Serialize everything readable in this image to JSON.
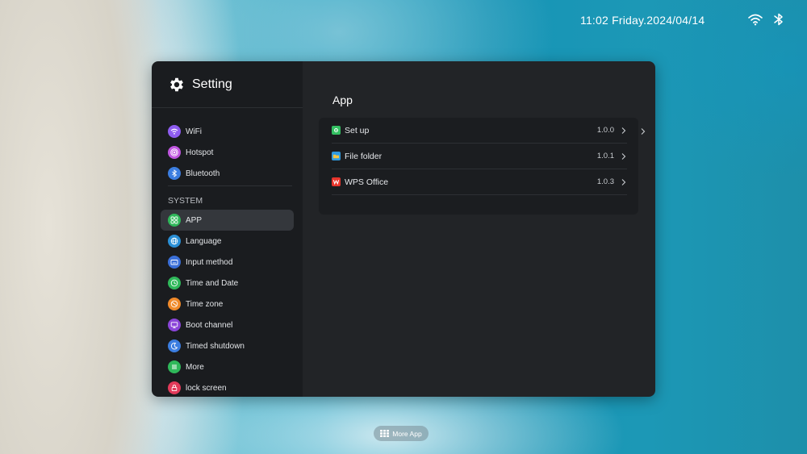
{
  "status_bar": {
    "datetime": "11:02 Friday.2024/04/14",
    "icons": [
      "wifi-icon",
      "bluetooth-icon"
    ]
  },
  "sidebar": {
    "title": "Setting",
    "network_items": [
      {
        "label": "WiFi",
        "icon": "wifi-icon",
        "color": "#8e5cf0"
      },
      {
        "label": "Hotspot",
        "icon": "hotspot-icon",
        "color": "#c056e0"
      },
      {
        "label": "Bluetooth",
        "icon": "bluetooth-icon",
        "color": "#3b7de0"
      }
    ],
    "section_label": "SYSTEM",
    "system_items": [
      {
        "label": "APP",
        "icon": "app-grid-icon",
        "color": "#2fb85a",
        "active": true
      },
      {
        "label": "Language",
        "icon": "globe-icon",
        "color": "#2a8fd6"
      },
      {
        "label": "Input method",
        "icon": "keyboard-icon",
        "color": "#3a6fd8"
      },
      {
        "label": "Time and Date",
        "icon": "clock-icon",
        "color": "#2fb85a"
      },
      {
        "label": "Time zone",
        "icon": "timezone-icon",
        "color": "#f08a2a"
      },
      {
        "label": "Boot channel",
        "icon": "monitor-icon",
        "color": "#8a45d8"
      },
      {
        "label": "Timed shutdown",
        "icon": "moon-icon",
        "color": "#3b7de0"
      },
      {
        "label": "More",
        "icon": "menu-icon",
        "color": "#2fb85a"
      },
      {
        "label": "lock screen",
        "icon": "lock-icon",
        "color": "#e23a5a"
      }
    ]
  },
  "content": {
    "title": "App",
    "apps": [
      {
        "name": "Set up",
        "version": "1.0.0",
        "icon": "setup-icon",
        "color": "#34c062"
      },
      {
        "name": "File folder",
        "version": "1.0.1",
        "icon": "folder-icon",
        "color": "#2f9be0"
      },
      {
        "name": "WPS Office",
        "version": "1.0.3",
        "icon": "wps-icon",
        "color": "#e8352c"
      }
    ]
  },
  "dock": {
    "more_app_label": "More App"
  }
}
